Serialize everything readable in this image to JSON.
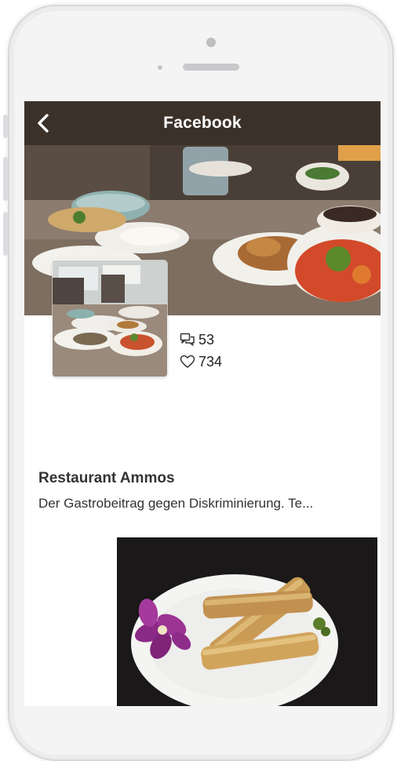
{
  "header": {
    "title": "Facebook"
  },
  "stats": {
    "comments": "53",
    "likes": "734"
  },
  "post": {
    "title": "Restaurant Ammos",
    "excerpt": "Der Gastrobeitrag gegen Diskriminierung. Te..."
  },
  "colors": {
    "topbar": "#3b3129",
    "background": "#ffffff",
    "text": "#333333"
  },
  "icons": {
    "back": "chevron-left-icon",
    "comments": "comments-icon",
    "likes": "heart-icon"
  }
}
